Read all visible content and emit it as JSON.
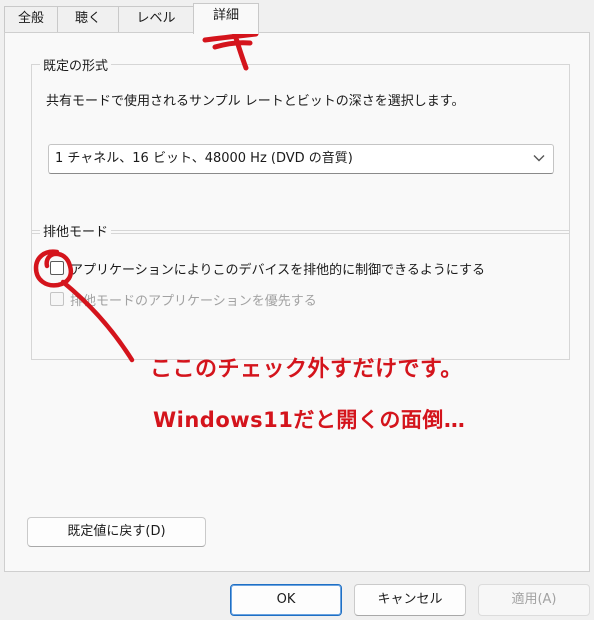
{
  "tabs": [
    {
      "label": "全般"
    },
    {
      "label": "聴く"
    },
    {
      "label": "レベル"
    },
    {
      "label": "詳細",
      "active": true
    }
  ],
  "default_format": {
    "legend": "既定の形式",
    "description": "共有モードで使用されるサンプル レートとビットの深さを選択します。",
    "selected_value": "1 チャネル、16 ビット、48000 Hz (DVD の音質)"
  },
  "exclusive_mode": {
    "legend": "排他モード",
    "allow_exclusive_label": "アプリケーションによりこのデバイスを排他的に制御できるようにする",
    "allow_exclusive_checked": false,
    "priority_label": "排他モードのアプリケーションを優先する",
    "priority_checked": false,
    "priority_enabled": false
  },
  "restore_defaults_button": "既定値に戻す(D)",
  "footer": {
    "ok": "OK",
    "cancel": "キャンセル",
    "apply": "適用(A)"
  },
  "annotation": {
    "line1": "ここのチェック外すだけです。",
    "line2": "Windows11だと開くの面倒…",
    "color": "#d4141c"
  }
}
